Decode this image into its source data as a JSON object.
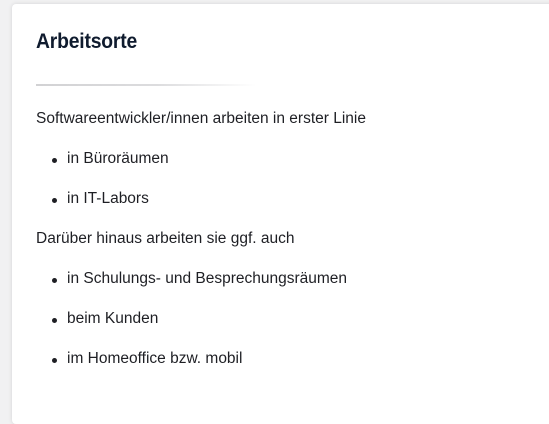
{
  "section": {
    "title": "Arbeitsorte"
  },
  "intro1": "Softwareentwickler/innen arbeiten in erster Linie",
  "list1": [
    "in Büroräumen",
    "in IT-Labors"
  ],
  "intro2": "Darüber hinaus arbeiten sie ggf. auch",
  "list2": [
    "in Schulungs- und Besprechungsräumen",
    "beim Kunden",
    "im Homeoffice bzw. mobil"
  ]
}
